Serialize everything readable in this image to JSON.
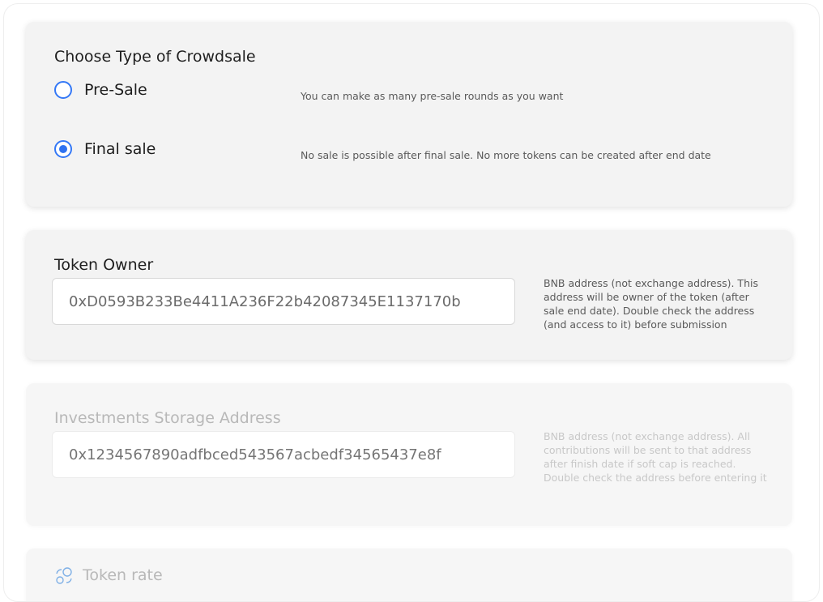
{
  "crowdsale_type": {
    "title": "Choose Type of Crowdsale",
    "options": [
      {
        "label": "Pre-Sale",
        "hint": "You can make as many pre-sale rounds as you want",
        "selected": false
      },
      {
        "label": "Final sale",
        "hint": "No sale is possible after final sale. No more tokens can be created after end date",
        "selected": true
      }
    ]
  },
  "token_owner": {
    "title": "Token Owner",
    "value": "0xD0593B233Be4411A236F22b42087345E1137170b",
    "hint": "BNB address (not exchange address). This address will be owner of the token (after sale end date). Double check the address (and access to it) before submission"
  },
  "investments_storage": {
    "title": "Investments Storage Address",
    "placeholder": "0x1234567890adfbced543567acbedf34565437e8f",
    "hint": "BNB address (not exchange address). All contributions will be sent to that address after finish date if soft cap is reached. Double check the address before entering it"
  },
  "token_rate": {
    "title": "Token rate",
    "icon": "token-rate-icon"
  },
  "colors": {
    "accent": "#2f72f0",
    "card_bg": "#f3f3f3"
  }
}
